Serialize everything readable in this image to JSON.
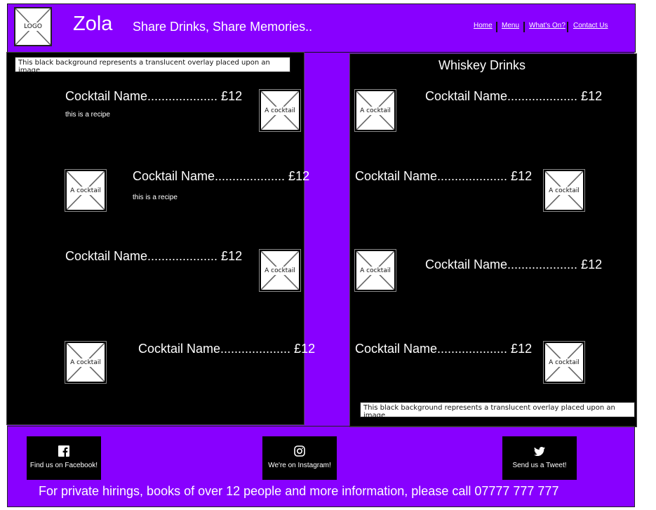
{
  "header": {
    "logo_label": "LOGO",
    "brand": "Zola",
    "tagline": "Share Drinks, Share Memories..",
    "nav": [
      "Home",
      "Menu",
      "What's On?",
      "Contact Us"
    ]
  },
  "colors": {
    "accent": "#8800ff",
    "panel": "#000000",
    "text": "#ffffff"
  },
  "left_panel": {
    "overlay_note": "This black background represents a translucent overlay placed upon an image",
    "items": [
      {
        "name": "Cocktail Name.................... £12",
        "recipe": "this is a recipe",
        "image_label": "A cocktail"
      },
      {
        "name": "Cocktail Name.................... £12",
        "recipe": "this is a recipe",
        "image_label": "A cocktail"
      },
      {
        "name": "Cocktail Name.................... £12",
        "image_label": "A cocktail"
      },
      {
        "name": "Cocktail Name.................... £12",
        "image_label": "A cocktail"
      }
    ]
  },
  "right_panel": {
    "title": "Whiskey Drinks",
    "overlay_note": "This black background represents a translucent overlay placed upon an image",
    "items": [
      {
        "name": "Cocktail Name.................... £12",
        "image_label": "A cocktail"
      },
      {
        "name": "Cocktail Name.................... £12",
        "image_label": "A cocktail"
      },
      {
        "name": "Cocktail Name.................... £12",
        "image_label": "A cocktail"
      },
      {
        "name": "Cocktail Name.................... £12",
        "image_label": "A cocktail"
      }
    ]
  },
  "footer": {
    "social": [
      {
        "label": "Find us on Facebook!",
        "icon": "facebook-icon"
      },
      {
        "label": "We're on Instagram!",
        "icon": "instagram-icon"
      },
      {
        "label": "Send us a Tweet!",
        "icon": "twitter-icon"
      }
    ],
    "contact_text": "For private hirings, books of over 12 people and more information, please call 07777 777 777"
  }
}
